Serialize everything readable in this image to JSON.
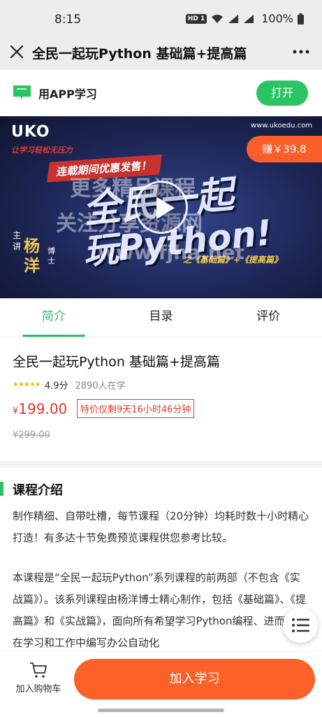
{
  "status_bar": {
    "time": "8:15",
    "hd": "HD 1",
    "battery": "100%"
  },
  "header": {
    "title": "全民一起玩Python 基础篇+提高篇"
  },
  "app_banner": {
    "label": "用APP学习",
    "open_label": "打开"
  },
  "cover": {
    "logo": "UKO",
    "slogan": "让学习轻松无压力",
    "url": "www.ukoedu.com",
    "earn_label": "赚￥39.8",
    "promo": "连载期间优惠发售！",
    "big_line1": "全民一起",
    "big_line2": "玩Python!",
    "subtitle": "之《基础篇》+《提高篇》",
    "teacher_tag": "主讲",
    "teacher_name": "杨洋",
    "teacher_title": "博士",
    "watermark1": "更多精品课程",
    "watermark2": "关注分享资源网",
    "watermark3": "www.fjha.net"
  },
  "tabs": [
    {
      "label": "简介",
      "active": true
    },
    {
      "label": "目录",
      "active": false
    },
    {
      "label": "评价",
      "active": false
    }
  ],
  "course": {
    "title": "全民一起玩Python 基础篇+提高篇",
    "stars": "★★★★★",
    "score": "4.9分",
    "learners": "2890人在学",
    "price_symbol": "¥",
    "price": "199.00",
    "countdown": "特价仅剩9天16小时46分钟",
    "old_price": "¥299.00"
  },
  "intro": {
    "heading": "课程介绍",
    "p1": "制作精细、自带吐槽，每节课程（20分钟）均耗时数十小时精心打造！有多达十节免费预览课程供您参考比较。",
    "p2": "本课程是“全民一起玩Python”系列课程的前两部（不包含《实战篇》）。该系列课程由杨洋博士精心制作，包括《基础篇》、《提高篇》和《实战篇》，面向所有希望学习Python编程、进而能够在学习和工作中编写办公自动化"
  },
  "bottom_bar": {
    "cart_label": "加入购物车",
    "join_label": "加入学习"
  },
  "colors": {
    "accent_green": "#2bc463",
    "accent_orange": "#fb6128",
    "price_red": "#e8372c"
  }
}
